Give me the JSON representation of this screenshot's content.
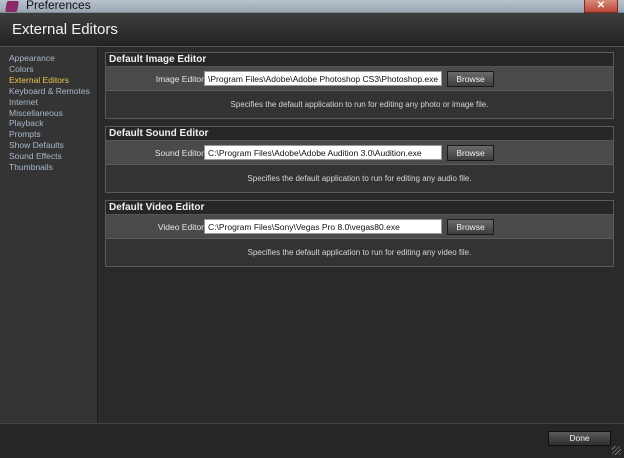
{
  "window": {
    "title": "Preferences",
    "close_glyph": "✕"
  },
  "header": {
    "title": "External Editors"
  },
  "sidebar": {
    "items": [
      {
        "label": "Appearance"
      },
      {
        "label": "Colors"
      },
      {
        "label": "External Editors",
        "active": true
      },
      {
        "label": "Keyboard & Remotes"
      },
      {
        "label": "Internet"
      },
      {
        "label": "Miscellaneous"
      },
      {
        "label": "Playback"
      },
      {
        "label": "Prompts"
      },
      {
        "label": "Show Defaults"
      },
      {
        "label": "Sound Effects"
      },
      {
        "label": "Thumbnails"
      }
    ]
  },
  "sections": {
    "image": {
      "title": "Default Image Editor",
      "label": "Image Editor",
      "path": "\\Program Files\\Adobe\\Adobe Photoshop CS3\\Photoshop.exe",
      "browse_label": "Browse",
      "description": "Specifies the default application to run for editing any photo or image file."
    },
    "sound": {
      "title": "Default Sound Editor",
      "label": "Sound Editor",
      "path": "C:\\Program Files\\Adobe\\Adobe Audition 3.0\\Audition.exe",
      "browse_label": "Browse",
      "description": "Specifies the default application to run for editing any audio file."
    },
    "video": {
      "title": "Default Video Editor",
      "label": "Video Editor",
      "path": "C:\\Program Files\\Sony\\Vegas Pro 8.0\\vegas80.exe",
      "browse_label": "Browse",
      "description": "Specifies the default application to run for editing any video file."
    }
  },
  "footer": {
    "done_label": "Done"
  },
  "colors": {
    "active_nav": "#e9c84a",
    "nav": "#a9b9cc",
    "background": "#2a2a2a"
  }
}
